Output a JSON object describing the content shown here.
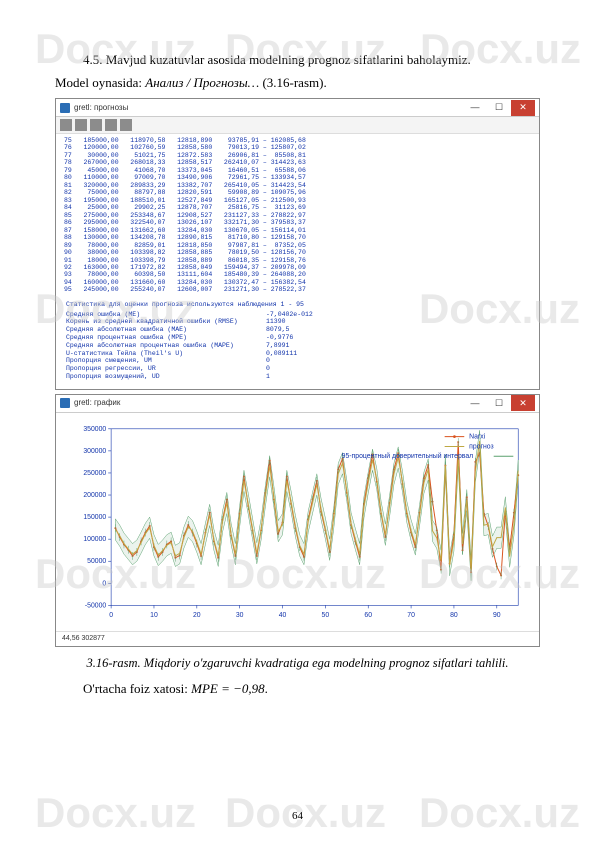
{
  "watermark": "Docx.uz",
  "paragraphs": {
    "intro1": "4.5. Mavjud kuzatuvlar asosida modelning prognoz sifatlarini baholaymiz.",
    "intro2_pre": "Model oynasida: ",
    "intro2_italic": "Анализ / Прогнозы…",
    "intro2_post": " (3.16-rasm)."
  },
  "window1": {
    "title": "gretl: прогнозы",
    "data_rows": [
      "75   185000,00   118970,58   12818,890    93785,91 – 162085,68",
      "76   120000,00   102760,59   12858,580    79013,19 – 125807,02",
      "77    30000,00    51021,75   12872.583    26906,81 –  85508,81",
      "78   267000,00   268018,33   12858,517   262410,07 – 314423,63",
      "79    45000,00    41068,70   13373,045    16460,51 –  65588,06",
      "80   110000,00    97009,70   13490,906    72961,75 – 133934,57",
      "81   320000,00   289833,29   13382,707   265410,05 – 314423,54",
      "82    75000,00    88797,88   12820,591    59908,89 – 109075,96",
      "83   195000,00   188510,01   12527,849   165127,05 – 212500,93",
      "84    25000,00    29902,25   12878,707    25816,75 –  31123,69",
      "85   275000,00   253348,67   12908,527   231127,33 – 278822,97",
      "86   295000,00   322540,07   13026,107   332171,30 – 379583,37",
      "87   158000,00   131662,60   13284,030   130670,05 – 156114,01",
      "88   130000,00   134208,78   12890,815    81710,80 – 129158,70",
      "89    78000,00    82859,01   12818,850    97987,81 –  87352,05",
      "90    38000,00   103398,82   12858,885    78019,50 – 128156,70",
      "91    18000,00   103398,79   12858,889    86018,35 – 129158,76",
      "92   163000,00   171972,82   12858,049   159494,37 – 209978,09",
      "93    78000,00    60398,50   13111,604   185480,39 – 264088,20",
      "94   160000,00   131660,60   13284,030   130372,47 – 156382,54",
      "95   245000,00   255240,07   12608,007   231271,30 – 278522,37"
    ],
    "stats_title": "Статистика для оценки прогноза используются наблюдения 1 - 95",
    "stats": [
      {
        "label": "Средняя ошибка (ME)",
        "value": "-7,0402e-012"
      },
      {
        "label": "Корень из средней квадратичной ошибки (RMSE)",
        "value": "11390"
      },
      {
        "label": "Средняя абсолютная ошибка (MAE)",
        "value": "8079,5"
      },
      {
        "label": "Средняя процентная ошибка (MPE)",
        "value": "-0,9776"
      },
      {
        "label": "Средняя абсолютная процентная ошибка (MAPE)",
        "value": "7,8991"
      },
      {
        "label": "U-статистика Тейла (Theil's U)",
        "value": "0,089111"
      },
      {
        "label": "Пропорция смещения, UM",
        "value": "0"
      },
      {
        "label": "Пропорция регрессии, UR",
        "value": "0"
      },
      {
        "label": "Пропорция возмущений, UD",
        "value": "1"
      }
    ]
  },
  "window2": {
    "title": "gretl: график",
    "status": "44,56 302877",
    "legend": {
      "series1": "Narxi",
      "series2": "прогноз",
      "series3": "95-процентный доверительный интервал"
    }
  },
  "chart_data": {
    "type": "line",
    "title": "",
    "xlabel": "",
    "ylabel": "",
    "xlim": [
      0,
      95
    ],
    "ylim": [
      -50000,
      350000
    ],
    "x_ticks": [
      0,
      10,
      20,
      30,
      40,
      50,
      60,
      70,
      80,
      90
    ],
    "y_ticks": [
      -50000,
      0,
      50000,
      100000,
      150000,
      200000,
      250000,
      300000,
      350000
    ],
    "series": [
      {
        "name": "Narxi",
        "color": "#d9531e",
        "values": [
          125000,
          105000,
          88000,
          76000,
          62000,
          71000,
          95000,
          115000,
          130000,
          82000,
          60000,
          71000,
          88000,
          95000,
          58000,
          63000,
          108000,
          132000,
          115000,
          90000,
          62000,
          115000,
          160000,
          95000,
          58000,
          144000,
          190000,
          108000,
          62000,
          158000,
          242000,
          175000,
          120000,
          62000,
          120000,
          205000,
          278000,
          190000,
          112000,
          138000,
          242000,
          180000,
          125000,
          82000,
          60000,
          145000,
          190000,
          232000,
          162000,
          120000,
          71000,
          158000,
          258000,
          282000,
          205000,
          132000,
          95000,
          60000,
          180000,
          238000,
          292000,
          230000,
          158000,
          105000,
          182000,
          258000,
          295000,
          225000,
          158000,
          115000,
          82000,
          160000,
          238000,
          268000,
          185000,
          120000,
          31000,
          267000,
          45000,
          110000,
          320000,
          75000,
          195000,
          25000,
          275000,
          295000,
          158000,
          130000,
          78000,
          38000,
          18000,
          163000,
          78000,
          160000,
          245000
        ]
      },
      {
        "name": "прогноз",
        "color": "#bfa843",
        "values": [
          122000,
          108000,
          90000,
          78000,
          66000,
          74000,
          92000,
          112000,
          126000,
          86000,
          64000,
          74000,
          86000,
          92000,
          62000,
          68000,
          104000,
          128000,
          118000,
          94000,
          66000,
          112000,
          155000,
          98000,
          62000,
          140000,
          182000,
          112000,
          66000,
          152000,
          232000,
          180000,
          124000,
          68000,
          122000,
          198000,
          265000,
          195000,
          118000,
          134000,
          232000,
          185000,
          130000,
          86000,
          66000,
          140000,
          182000,
          224000,
          168000,
          124000,
          76000,
          152000,
          248000,
          272000,
          210000,
          136000,
          100000,
          66000,
          172000,
          228000,
          280000,
          236000,
          162000,
          110000,
          176000,
          248000,
          285000,
          230000,
          162000,
          120000,
          88000,
          155000,
          228000,
          258000,
          118971,
          102761,
          51022,
          268018,
          41069,
          97010,
          289833,
          88798,
          188510,
          29902,
          253349,
          322540,
          131663,
          134209,
          82859,
          103399,
          103399,
          171973,
          60399,
          131661,
          255240
        ]
      }
    ]
  },
  "caption": "3.16-rasm. Miqdoriy o'zgaruvchi kvadratiga ega modelning prognoz sifatlari tahlili.",
  "mpe": {
    "label": "O'rtacha foiz xatosi: ",
    "formula": "MPE = −0,98"
  },
  "page_number": "64"
}
